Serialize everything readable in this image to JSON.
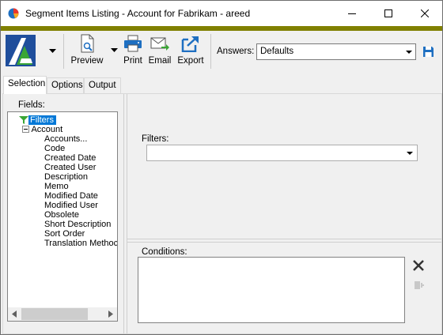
{
  "window": {
    "title": "Segment Items Listing - Account for Fabrikam - areed",
    "accent_color": "#808000"
  },
  "toolbar": {
    "preview_label": "Preview",
    "print_label": "Print",
    "email_label": "Email",
    "export_label": "Export",
    "answers_label": "Answers:",
    "answers_value": "Defaults"
  },
  "tabs": [
    "Selection",
    "Options",
    "Output"
  ],
  "active_tab": "Selection",
  "fields": {
    "label": "Fields:",
    "tree": {
      "root": "Filters",
      "group": "Account",
      "items": [
        "Accounts...",
        "Code",
        "Created Date",
        "Created User",
        "Description",
        "Memo",
        "Modified Date",
        "Modified User",
        "Obsolete",
        "Short Description",
        "Sort Order",
        "Translation Methoc"
      ]
    }
  },
  "filters": {
    "label": "Filters:",
    "value": ""
  },
  "conditions": {
    "label": "Conditions:"
  },
  "icons": {
    "app": "pie-chart-icon",
    "min": "minimize-icon",
    "max": "maximize-icon",
    "close": "close-icon",
    "preview": "preview-document-icon",
    "print": "printer-icon",
    "email": "envelope-icon",
    "export": "export-arrow-icon",
    "save": "save-disk-icon"
  }
}
